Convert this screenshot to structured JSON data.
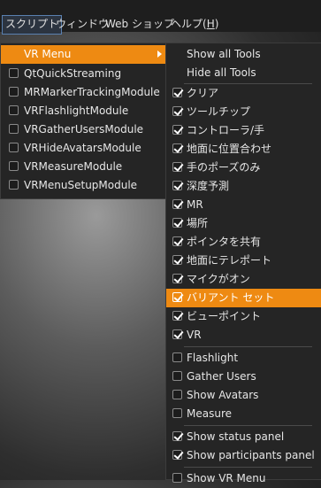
{
  "menubar": {
    "items": [
      {
        "label": "スクリプト",
        "active": true
      },
      {
        "label": "ウィンドウ"
      },
      {
        "label": "Web ショップ"
      },
      {
        "label": "ヘルプ(",
        "mnemonic": "H",
        "suffix": ")"
      }
    ]
  },
  "script_menu": {
    "vr_menu_label": "VR Menu",
    "modules": [
      {
        "label": "QtQuickStreaming",
        "checked": false
      },
      {
        "label": "MRMarkerTrackingModule",
        "checked": false
      },
      {
        "label": "VRFlashlightModule",
        "checked": false
      },
      {
        "label": "VRGatherUsersModule",
        "checked": false
      },
      {
        "label": "VRHideAvatarsModule",
        "checked": false
      },
      {
        "label": "VRMeasureModule",
        "checked": false
      },
      {
        "label": "VRMenuSetupModule",
        "checked": false
      }
    ]
  },
  "vr_submenu": {
    "show_all": "Show all Tools",
    "hide_all": "Hide all Tools",
    "tools": [
      {
        "label": "クリア",
        "checked": true
      },
      {
        "label": "ツールチップ",
        "checked": true
      },
      {
        "label": "コントローラ/手",
        "checked": true
      },
      {
        "label": "地面に位置合わせ",
        "checked": true
      },
      {
        "label": "手のポーズのみ",
        "checked": true
      },
      {
        "label": "深度予測",
        "checked": true
      },
      {
        "label": "MR",
        "checked": true
      },
      {
        "label": "場所",
        "checked": true
      },
      {
        "label": "ポインタを共有",
        "checked": true
      },
      {
        "label": "地面にテレポート",
        "checked": true
      },
      {
        "label": "マイクがオン",
        "checked": true
      },
      {
        "label": "バリアント セット",
        "checked": true,
        "highlighted": true
      },
      {
        "label": "ビューポイント",
        "checked": true
      },
      {
        "label": "VR",
        "checked": true
      }
    ],
    "module_tools": [
      {
        "label": "Flashlight",
        "checked": false
      },
      {
        "label": "Gather Users",
        "checked": false
      },
      {
        "label": "Show Avatars",
        "checked": false
      },
      {
        "label": "Measure",
        "checked": false
      }
    ],
    "panels": [
      {
        "label": "Show status panel",
        "checked": true
      },
      {
        "label": "Show participants panel",
        "checked": true
      }
    ],
    "show_vr_menu": {
      "label": "Show VR Menu",
      "checked": false
    }
  },
  "colors": {
    "highlight": "#ee8a12",
    "menu_background": "#252525",
    "menubar_background": "#1e1e1e"
  }
}
